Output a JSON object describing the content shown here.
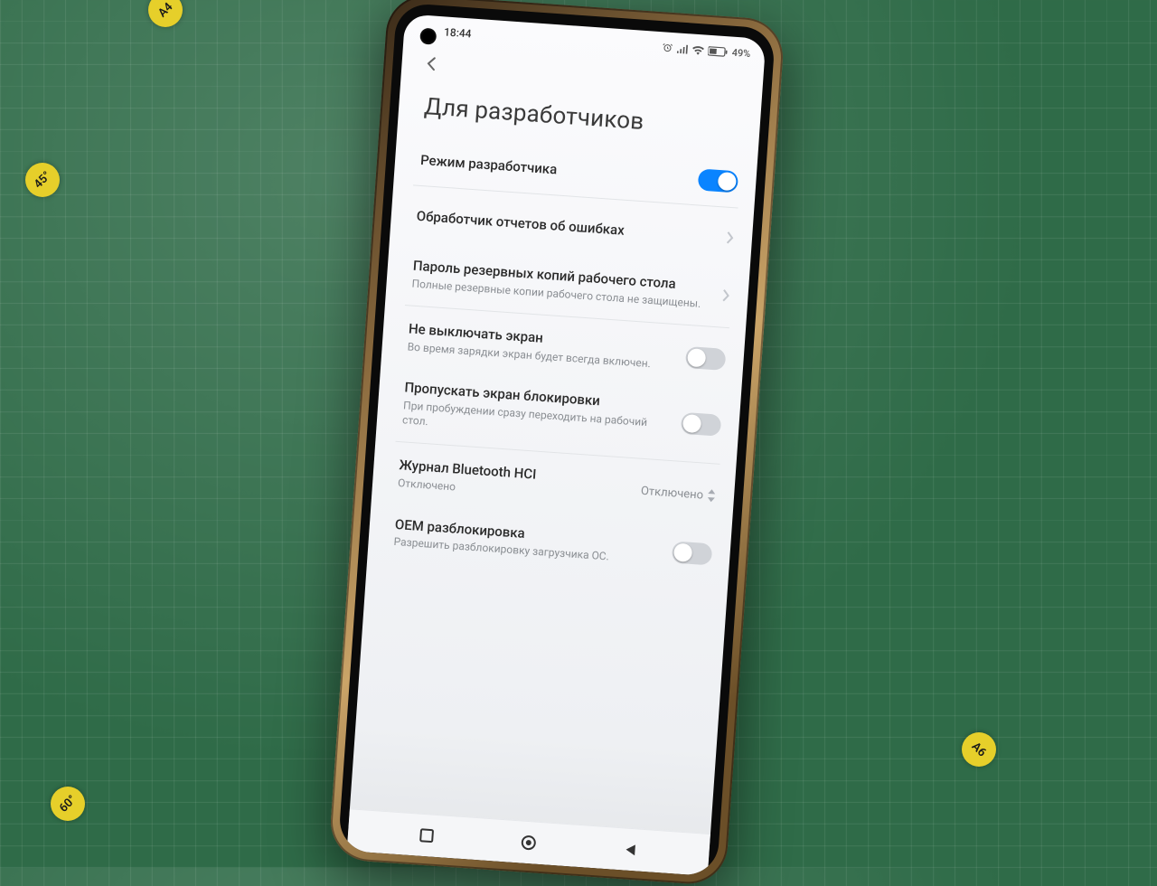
{
  "mat": {
    "m1": "45°",
    "m2": "60°",
    "m3": "A6",
    "m4": "A4"
  },
  "statusbar": {
    "time": "18:44",
    "battery": "49%"
  },
  "page": {
    "title": "Для разработчиков"
  },
  "rows": {
    "dev_mode": {
      "title": "Режим разработчика"
    },
    "bug_handler": {
      "title": "Обработчик отчетов об ошибках"
    },
    "backup_pw": {
      "title": "Пароль резервных копий рабочего стола",
      "sub": "Полные резервные копии рабочего стола не защищены."
    },
    "stay_awake": {
      "title": "Не выключать экран",
      "sub": "Во время зарядки экран будет всегда включен."
    },
    "skip_lock": {
      "title": "Пропускать экран блокировки",
      "sub": "При пробуждении сразу переходить на рабочий стол."
    },
    "bt_hci": {
      "title": "Журнал Bluetooth HCI",
      "sub": "Отключено",
      "value": "Отключено"
    },
    "oem_unlock": {
      "title": "OEM разблокировка",
      "sub": "Разрешить разблокировку загрузчика ОС."
    }
  },
  "toggles": {
    "dev_mode": true,
    "stay_awake": false,
    "skip_lock": false,
    "oem_unlock": false
  }
}
